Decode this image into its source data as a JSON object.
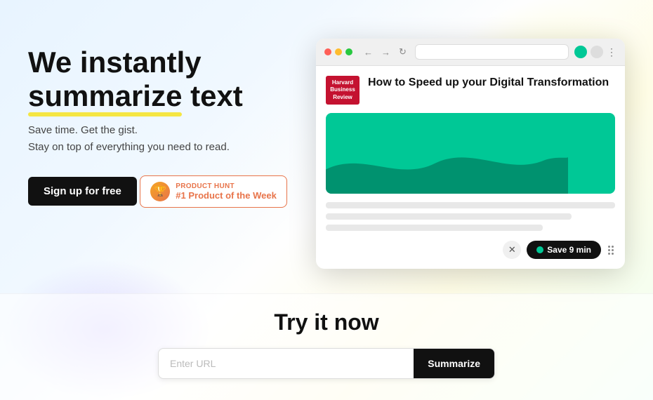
{
  "hero": {
    "title_start": "We instantly ",
    "title_highlight": "summarize",
    "title_end": " text",
    "subtitle_line1": "Save time. Get the gist.",
    "subtitle_line2": "Stay on top of everything you need to read.",
    "signup_label": "Sign up for free"
  },
  "product_hunt": {
    "label": "Product Hunt",
    "rank": "#1 Product of the Week",
    "trophy": "🏆"
  },
  "browser": {
    "address": "",
    "article_logo_line1": "Harvard",
    "article_logo_line2": "Business",
    "article_logo_line3": "Review",
    "article_title": "How to Speed up your Digital Transformation",
    "save_label": "Save 9 min"
  },
  "try_section": {
    "title": "Try it now",
    "url_placeholder": "Enter URL",
    "summarize_label": "Summarize"
  }
}
